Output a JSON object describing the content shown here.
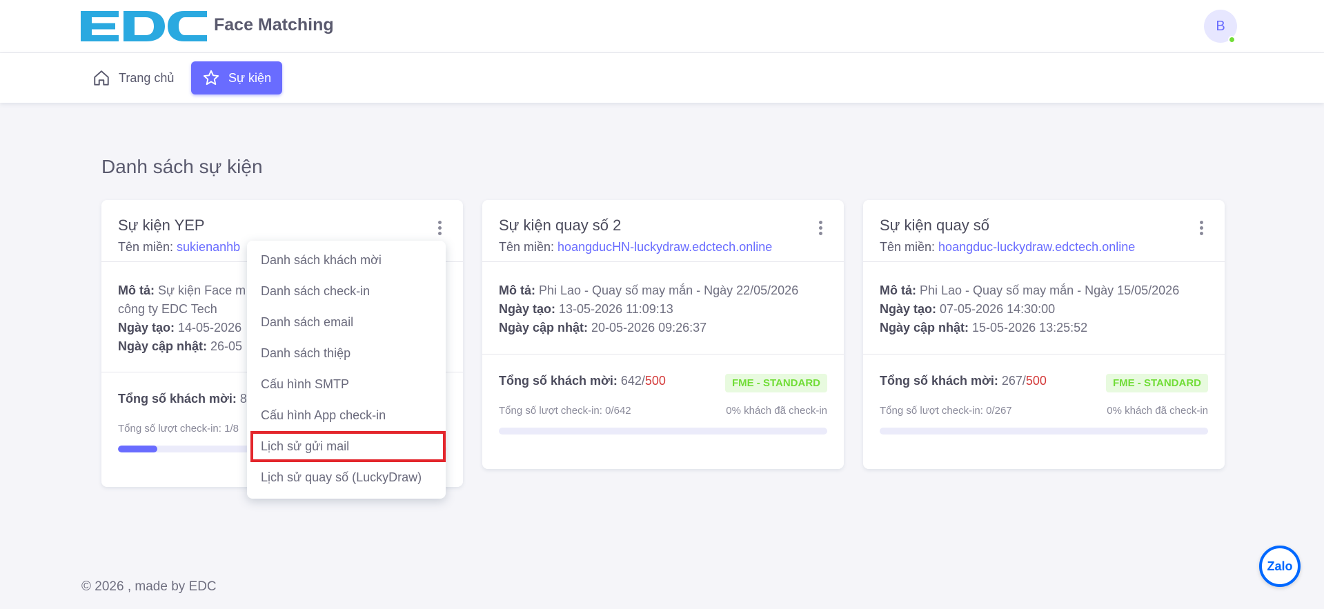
{
  "header": {
    "logo_text": "EDC",
    "app_title": "Face Matching",
    "avatar_initial": "B",
    "brand_color": "#696cff",
    "online_color": "#71dd37"
  },
  "nav": {
    "items": [
      {
        "label": "Trang chủ",
        "icon": "home-icon",
        "active": false
      },
      {
        "label": "Sự kiện",
        "icon": "star-icon",
        "active": true
      }
    ]
  },
  "main": {
    "title": "Danh sách sự kiện"
  },
  "labels": {
    "domain": "Tên miền: ",
    "description": "Mô tả: ",
    "created": "Ngày tạo: ",
    "updated": "Ngày cập nhật: ",
    "total_guests": "Tổng số khách mời: ",
    "checkins": "Tổng số lượt check-in: "
  },
  "events": [
    {
      "name": "Sự kiện YEP",
      "domain": "sukienanhb",
      "description": "Sự kiện Face m",
      "description_line2": "công ty EDC Tech",
      "created": "14-05-2026",
      "updated": "26-05",
      "guests": "8",
      "limit": "",
      "badge": "",
      "checkin_text": "Tổng số lượt check-in: 1/8",
      "checkin_pct_text": "",
      "progress": 0.12
    },
    {
      "name": "Sự kiện quay số 2",
      "domain": "hoangducHN-luckydraw.edctech.online",
      "description": "Phi Lao - Quay số may mắn - Ngày 22/05/2026",
      "description_line2": "",
      "created": "13-05-2026 11:09:13",
      "updated": "20-05-2026 09:26:37",
      "guests": "642",
      "limit": "500",
      "badge": "FME - STANDARD",
      "checkin_text": "Tổng số lượt check-in: 0/642",
      "checkin_pct_text": "0% khách đã check-in",
      "progress": 0
    },
    {
      "name": "Sự kiện quay số",
      "domain": "hoangduc-luckydraw.edctech.online",
      "description": "Phi Lao - Quay số may mắn - Ngày 15/05/2026",
      "description_line2": "",
      "created": "07-05-2026 14:30:00",
      "updated": "15-05-2026 13:25:52",
      "guests": "267",
      "limit": "500",
      "badge": "FME - STANDARD",
      "checkin_text": "Tổng số lượt check-in: 0/267",
      "checkin_pct_text": "0% khách đã check-in",
      "progress": 0
    }
  ],
  "dropdown": {
    "items": [
      "Danh sách khách mời",
      "Danh sách check-in",
      "Danh sách email",
      "Danh sách thiệp",
      "Cấu hình SMTP",
      "Cấu hình App check-in",
      "Lịch sử gửi mail",
      "Lịch sử quay số (LuckyDraw)"
    ],
    "highlighted_index": 6
  },
  "footer": {
    "text": "© 2026 , made by EDC"
  },
  "chat_widget": {
    "label": "Zalo"
  }
}
